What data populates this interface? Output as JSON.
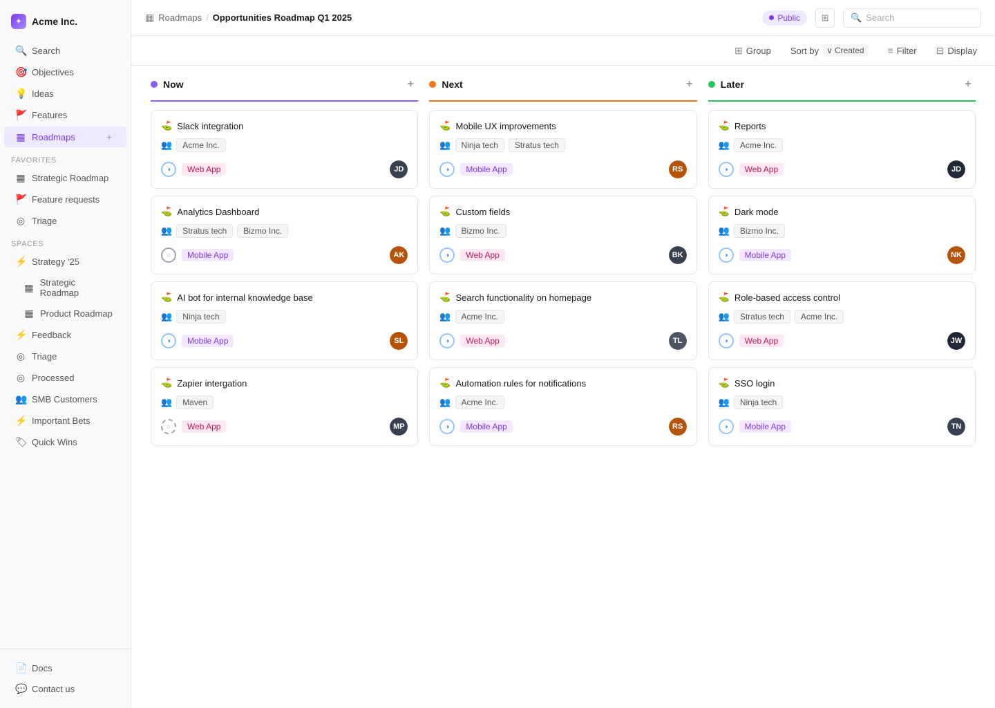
{
  "app": {
    "title": "Acme Inc.",
    "logo_label": "Acme Inc."
  },
  "header": {
    "breadcrumb_parent": "Roadmaps",
    "breadcrumb_current": "Opportunities Roadmap Q1 2025",
    "visibility": "Public",
    "search_placeholder": "Search"
  },
  "toolbar": {
    "group_label": "Group",
    "sort_label": "Sort by",
    "sort_value": "Created",
    "filter_label": "Filter",
    "display_label": "Display"
  },
  "sidebar": {
    "search": "Search",
    "objectives": "Objectives",
    "ideas": "Ideas",
    "features": "Features",
    "roadmaps": "Roadmaps",
    "favorites_section": "Favorites",
    "favorites": [
      {
        "label": "Strategic Roadmap"
      },
      {
        "label": "Feature requests"
      },
      {
        "label": "Triage"
      }
    ],
    "spaces_section": "Spaces",
    "spaces": [
      {
        "label": "Strategy '25",
        "type": "bolt"
      },
      {
        "label": "Strategic Roadmap",
        "type": "roadmap",
        "indent": true
      },
      {
        "label": "Product Roadmap",
        "type": "roadmap",
        "indent": true
      },
      {
        "label": "Feedback",
        "type": "bolt"
      },
      {
        "label": "Triage",
        "type": "circle"
      },
      {
        "label": "Processed",
        "type": "circle"
      },
      {
        "label": "SMB Customers",
        "type": "user"
      },
      {
        "label": "Important Bets",
        "type": "bolt"
      },
      {
        "label": "Quick Wins",
        "type": "tag"
      }
    ],
    "bottom": [
      {
        "label": "Docs"
      },
      {
        "label": "Contact us"
      }
    ]
  },
  "columns": [
    {
      "id": "now",
      "label": "Now",
      "dot_class": "now",
      "cards": [
        {
          "title": "Slack integration",
          "companies": [
            "Acme Inc."
          ],
          "app_tag": "Web App",
          "app_class": "web",
          "avatar_color": "#374151",
          "avatar_initials": "JD"
        },
        {
          "title": "Analytics Dashboard",
          "companies": [
            "Stratus tech",
            "Bizmo Inc."
          ],
          "app_tag": "Mobile App",
          "app_class": "mobile",
          "avatar_color": "#b45309",
          "avatar_initials": "AK",
          "status_class": "gray"
        },
        {
          "title": "AI bot for internal knowledge base",
          "companies": [
            "Ninja tech"
          ],
          "app_tag": "Mobile App",
          "app_class": "mobile",
          "avatar_color": "#b45309",
          "avatar_initials": "SL"
        },
        {
          "title": "Zapier intergation",
          "companies": [
            "Maven"
          ],
          "app_tag": "Web App",
          "app_class": "web",
          "avatar_color": "#374151",
          "avatar_initials": "MP",
          "status_class": "dashed"
        }
      ]
    },
    {
      "id": "next",
      "label": "Next",
      "dot_class": "next",
      "cards": [
        {
          "title": "Mobile UX improvements",
          "companies": [
            "Ninja tech",
            "Stratus tech"
          ],
          "app_tag": "Mobile App",
          "app_class": "mobile",
          "avatar_color": "#b45309",
          "avatar_initials": "RS"
        },
        {
          "title": "Custom fields",
          "companies": [
            "Bizmo Inc."
          ],
          "app_tag": "Web App",
          "app_class": "web",
          "avatar_color": "#374151",
          "avatar_initials": "BK"
        },
        {
          "title": "Search functionality on homepage",
          "companies": [
            "Acme Inc."
          ],
          "app_tag": "Web App",
          "app_class": "web",
          "avatar_color": "#4b5563",
          "avatar_initials": "TL"
        },
        {
          "title": "Automation rules for notifications",
          "companies": [
            "Acme Inc."
          ],
          "app_tag": "Mobile App",
          "app_class": "mobile",
          "avatar_color": "#b45309",
          "avatar_initials": "RS"
        }
      ]
    },
    {
      "id": "later",
      "label": "Later",
      "dot_class": "later",
      "cards": [
        {
          "title": "Reports",
          "companies": [
            "Acme Inc."
          ],
          "app_tag": "Web App",
          "app_class": "web",
          "avatar_color": "#1f2937",
          "avatar_initials": "JD"
        },
        {
          "title": "Dark mode",
          "companies": [
            "Bizmo Inc."
          ],
          "app_tag": "Mobile App",
          "app_class": "mobile",
          "avatar_color": "#b45309",
          "avatar_initials": "NK"
        },
        {
          "title": "Role-based access control",
          "companies": [
            "Stratus tech",
            "Acme Inc."
          ],
          "app_tag": "Web App",
          "app_class": "web",
          "avatar_color": "#1f2937",
          "avatar_initials": "JW"
        },
        {
          "title": "SSO login",
          "companies": [
            "Ninja tech"
          ],
          "app_tag": "Mobile App",
          "app_class": "mobile",
          "avatar_color": "#374151",
          "avatar_initials": "TN"
        }
      ]
    }
  ]
}
